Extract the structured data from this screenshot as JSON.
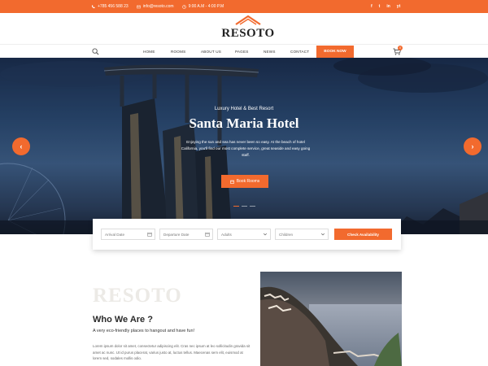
{
  "topbar": {
    "phone": "+785 456 588 23",
    "email": "info@resoto.com",
    "hours": "9:00 A.M - 4:00 P.M",
    "social": [
      "f",
      "t",
      "in",
      "yt"
    ]
  },
  "logo": {
    "brand": "RESOTO"
  },
  "nav": {
    "items": [
      "HOME",
      "ROOMS",
      "ABOUT US",
      "PAGES",
      "NEWS",
      "CONTACT"
    ],
    "book_now": "BOOK NOW",
    "cart_count": "0"
  },
  "hero": {
    "subtitle": "Luxury Hotel & Best Resort",
    "title": "Santa Maria Hotel",
    "description": "Enjoying the sun and sea has never been so easy. At the beach of hotel California, you'll find our most complete service, great seaside and easy going staff.",
    "cta": "Book Rooms",
    "prev_arrow": "‹",
    "next_arrow": "›"
  },
  "booking": {
    "arrival_placeholder": "Arrival Date",
    "departure_placeholder": "Departure Date",
    "adults_placeholder": "Adults",
    "children_placeholder": "Children",
    "check_label": "Check Availability"
  },
  "about": {
    "watermark": "RESOTO",
    "title": "Who We Are ?",
    "tagline": "A very eco-friendly places to hangout and have fun!",
    "body": "Lorem ipsum dolor sit amet, consectetur adipiscing elit. Cras nec ipsum at leo sollicitudin gravida sit amet ac nunc. Ut id purus placerat, varius justo at, luctus tellus. Maecenas sem elit, euismod at lorem sed, sodales mollis odio."
  },
  "colors": {
    "accent": "#f26a2e"
  },
  "icons": {
    "topbar": [
      "phone-icon",
      "email-icon",
      "clock-icon"
    ],
    "nav": [
      "search-icon",
      "cart-icon"
    ],
    "booking": [
      "calendar-icon",
      "chevron-down-icon"
    ]
  }
}
